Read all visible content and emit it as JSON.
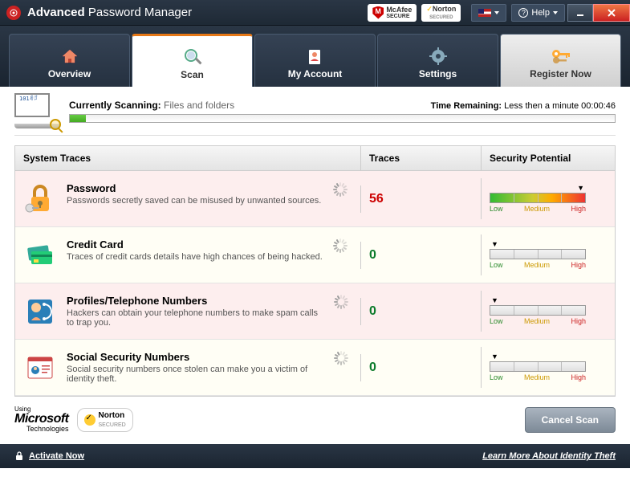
{
  "titlebar": {
    "title_bold": "Advanced",
    "title_rest": "Password Manager",
    "badges": {
      "mcafee": "McAfee\nSECURE",
      "norton": "Norton",
      "norton_sub": "SECURED"
    },
    "help": "Help",
    "flag": "US"
  },
  "tabs": [
    {
      "label": "Overview",
      "icon": "home"
    },
    {
      "label": "Scan",
      "icon": "magnifier",
      "active": true
    },
    {
      "label": "My Account",
      "icon": "person"
    },
    {
      "label": "Settings",
      "icon": "gear"
    },
    {
      "label": "Register Now",
      "icon": "key",
      "register": true
    }
  ],
  "scan": {
    "currently_label": "Currently Scanning:",
    "currently_value": "Files and folders",
    "time_label": "Time Remaining:",
    "time_value": "Less then a minute 00:00:46",
    "progress_pct": 3
  },
  "columns": {
    "c1": "System Traces",
    "c2": "Traces",
    "c3": "Security Potential"
  },
  "meter_labels": {
    "low": "Low",
    "med": "Medium",
    "high": "High"
  },
  "rows": [
    {
      "icon": "lock",
      "title": "Password",
      "desc": "Passwords secretly saved can be misused by unwanted sources.",
      "traces": 56,
      "level": "high"
    },
    {
      "icon": "cards",
      "title": "Credit Card",
      "desc": "Traces of credit cards details have high chances of being hacked.",
      "traces": 0,
      "level": "low"
    },
    {
      "icon": "phone",
      "title": "Profiles/Telephone Numbers",
      "desc": "Hackers can obtain your telephone numbers to make spam calls to trap you.",
      "traces": 0,
      "level": "low"
    },
    {
      "icon": "profile",
      "title": "Social Security Numbers",
      "desc": "Social security numbers once stolen can make you a victim of identity theft.",
      "traces": 0,
      "level": "low"
    }
  ],
  "footer": {
    "ms_using": "Using",
    "ms_name": "Microsoft",
    "ms_tech": "Technologies",
    "norton": "Norton",
    "norton_sec": "SECURED",
    "cancel": "Cancel Scan"
  },
  "bottombar": {
    "activate": "Activate Now",
    "learn": "Learn More About Identity Theft"
  }
}
